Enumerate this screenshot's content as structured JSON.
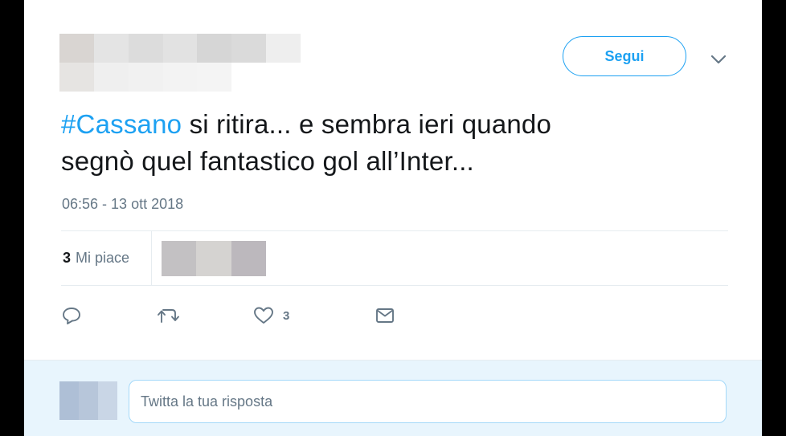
{
  "header": {
    "follow_label": "Segui"
  },
  "tweet": {
    "hashtag": "#Cassano",
    "text_line1_rest": " si ritira... e sembra ieri quando",
    "text_line2": "segnò quel fantastico gol all’Inter...",
    "timestamp": "06:56 - 13 ott 2018"
  },
  "stats": {
    "likes_count": "3",
    "likes_label": "Mi piace"
  },
  "actions": {
    "like_count": "3",
    "icons": [
      "reply-icon",
      "retweet-icon",
      "heart-icon",
      "message-icon"
    ]
  },
  "reply": {
    "placeholder": "Twitta la tua risposta"
  },
  "colors": {
    "accent": "#1da1f2",
    "text": "#14171a",
    "muted": "#657786",
    "reply_bg": "#e8f5fd"
  }
}
